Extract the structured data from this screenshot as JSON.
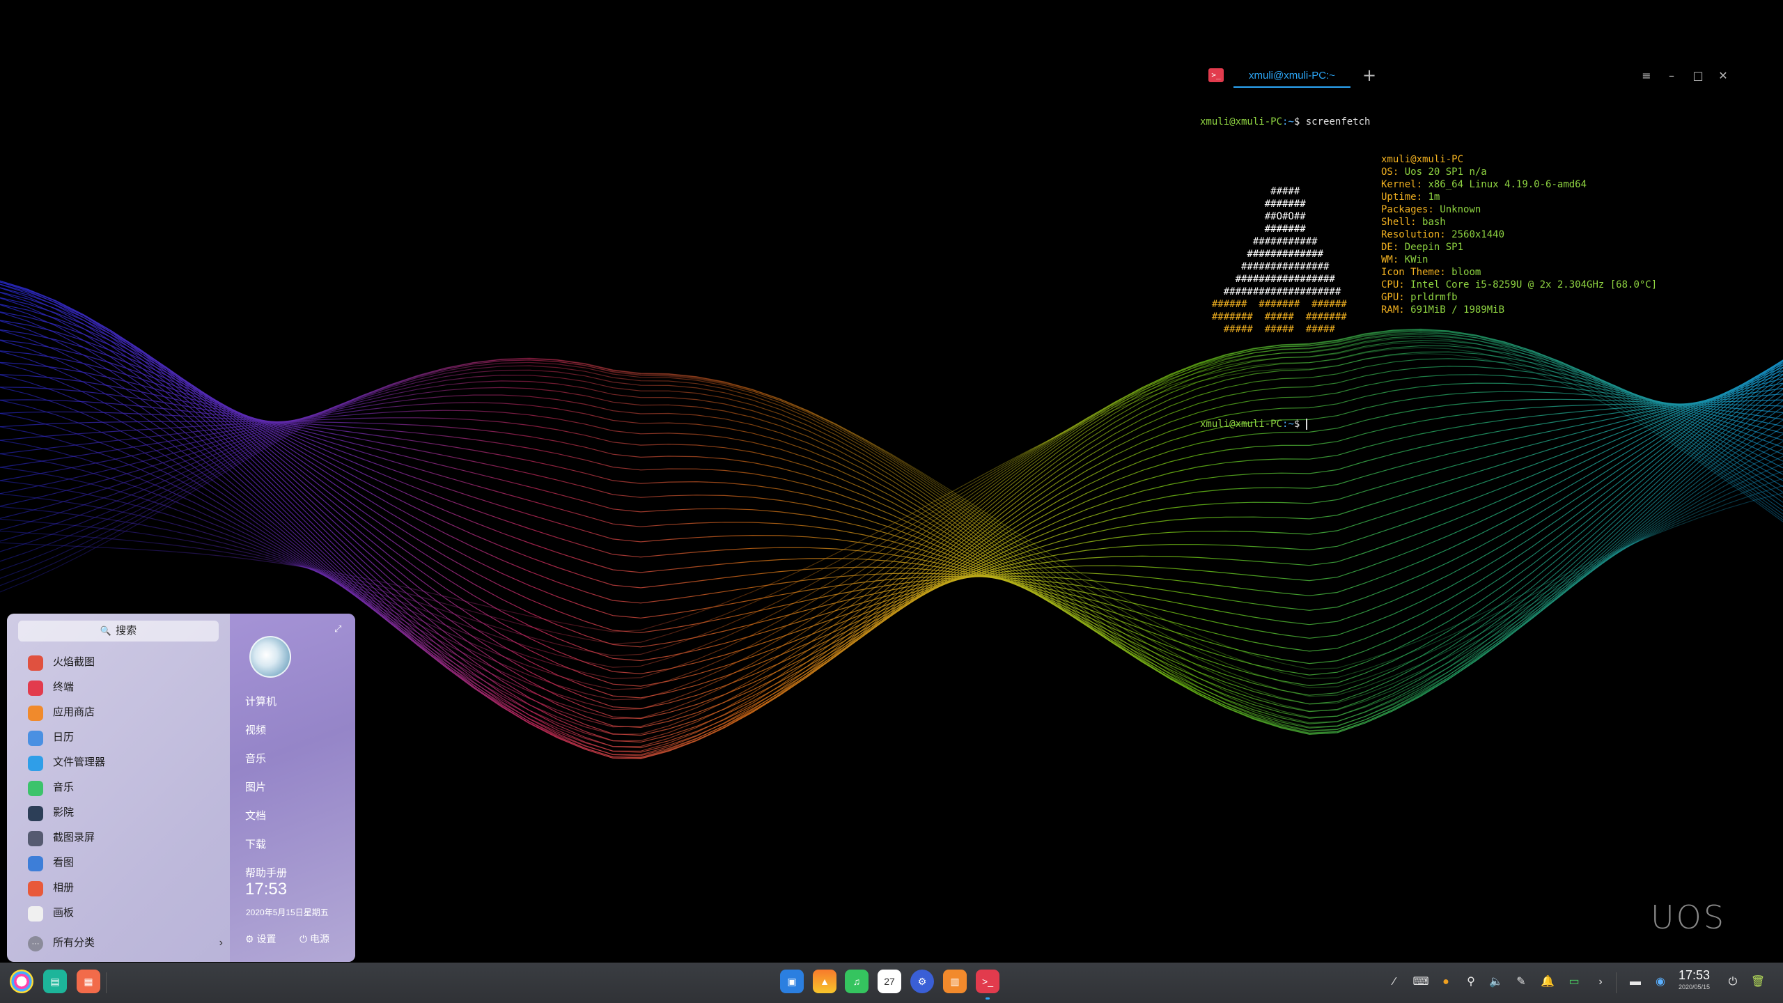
{
  "terminal": {
    "tab_title": "xmuli@xmuli-PC:~",
    "prompt_user": "xmuli@xmuli-PC",
    "prompt_path": ":~",
    "prompt_symbol": "$",
    "command": "screenfetch",
    "info": [
      {
        "label": "",
        "value": "xmuli@xmuli-PC"
      },
      {
        "label": "OS:",
        "value": "Uos 20 SP1 n/a"
      },
      {
        "label": "Kernel:",
        "value": "x86_64 Linux 4.19.0-6-amd64"
      },
      {
        "label": "Uptime:",
        "value": "1m"
      },
      {
        "label": "Packages:",
        "value": "Unknown"
      },
      {
        "label": "Shell:",
        "value": "bash"
      },
      {
        "label": "Resolution:",
        "value": "2560x1440"
      },
      {
        "label": "DE:",
        "value": "Deepin SP1"
      },
      {
        "label": "WM:",
        "value": "KWin"
      },
      {
        "label": "Icon Theme:",
        "value": "bloom"
      },
      {
        "label": "CPU:",
        "value": "Intel Core i5-8259U @ 2x 2.304GHz [68.0°C]"
      },
      {
        "label": "GPU:",
        "value": "prldrmfb"
      },
      {
        "label": "RAM:",
        "value": "691MiB / 1989MiB"
      }
    ],
    "logo_lines": [
      "            #####",
      "           #######",
      "           ##O#O##",
      "           #######",
      "         ###########",
      "        #############",
      "       ###############",
      "      #################",
      "    ####################",
      "  ######  #######  ######",
      "  #######  #####  #######",
      "    #####  #####  #####"
    ]
  },
  "launcher": {
    "search_placeholder": "搜索",
    "apps": [
      {
        "label": "火焰截图",
        "icon": "flameshot-icon",
        "color": "#e0513f"
      },
      {
        "label": "终端",
        "icon": "terminal-icon",
        "color": "#e23b4d"
      },
      {
        "label": "应用商店",
        "icon": "app-store-icon",
        "color": "#f08a2c"
      },
      {
        "label": "日历",
        "icon": "calendar-icon",
        "color": "#4a90e2"
      },
      {
        "label": "文件管理器",
        "icon": "file-manager-icon",
        "color": "#2f9ee8"
      },
      {
        "label": "音乐",
        "icon": "music-icon",
        "color": "#3cc36b"
      },
      {
        "label": "影院",
        "icon": "movie-icon",
        "color": "#2c3e57"
      },
      {
        "label": "截图录屏",
        "icon": "screen-capture-icon",
        "color": "#555a70"
      },
      {
        "label": "看图",
        "icon": "image-viewer-icon",
        "color": "#3d7ed8"
      },
      {
        "label": "相册",
        "icon": "album-icon",
        "color": "#e8593a"
      },
      {
        "label": "画板",
        "icon": "draw-icon",
        "color": "#f0f0f0"
      }
    ],
    "all_categories": "所有分类",
    "places": [
      "计算机",
      "视频",
      "音乐",
      "图片",
      "文档",
      "下载",
      "帮助手册"
    ],
    "time": "17:53",
    "date": "2020年5月15日星期五",
    "settings": "设置",
    "power": "电源"
  },
  "dock": {
    "time": "17:53",
    "date": "2020/05/15"
  },
  "watermark": "UOS"
}
